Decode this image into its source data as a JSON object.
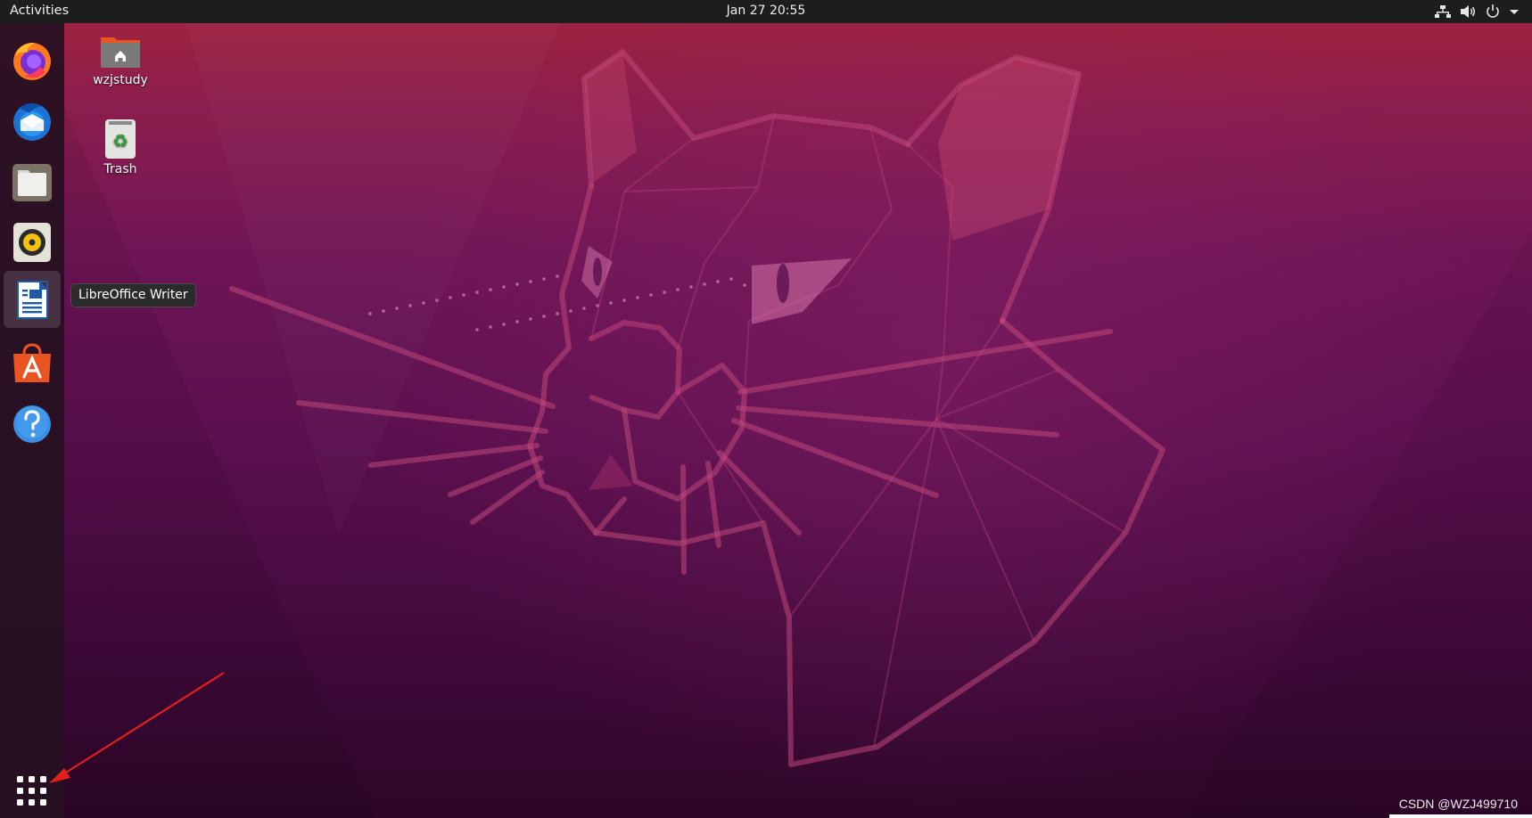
{
  "topbar": {
    "activities_label": "Activities",
    "clock": "Jan 27  20:55",
    "tray_icons": [
      "network-icon",
      "volume-icon",
      "power-icon",
      "chevron-down-icon"
    ]
  },
  "dock": {
    "apps": [
      {
        "name": "firefox-icon",
        "active": false
      },
      {
        "name": "thunderbird-icon",
        "active": false
      },
      {
        "name": "files-icon",
        "active": false
      },
      {
        "name": "rhythmbox-icon",
        "active": false
      },
      {
        "name": "libreoffice-writer-icon",
        "active": true
      },
      {
        "name": "ubuntu-software-icon",
        "active": false
      },
      {
        "name": "help-icon",
        "active": false
      }
    ],
    "show_applications_icon": "app-grid-icon"
  },
  "tooltip": {
    "text": "LibreOffice Writer"
  },
  "desktop_icons": [
    {
      "label": "wzjstudy",
      "icon": "home-folder-icon"
    },
    {
      "label": "Trash",
      "icon": "trash-icon"
    }
  ],
  "watermark": "CSDN @WZJ499710",
  "colors": {
    "topbar": "#1d1d1d",
    "wallpaper_top": "#a2243d",
    "wallpaper_bottom": "#2d0628",
    "annotation_arrow": "#e0201a"
  }
}
